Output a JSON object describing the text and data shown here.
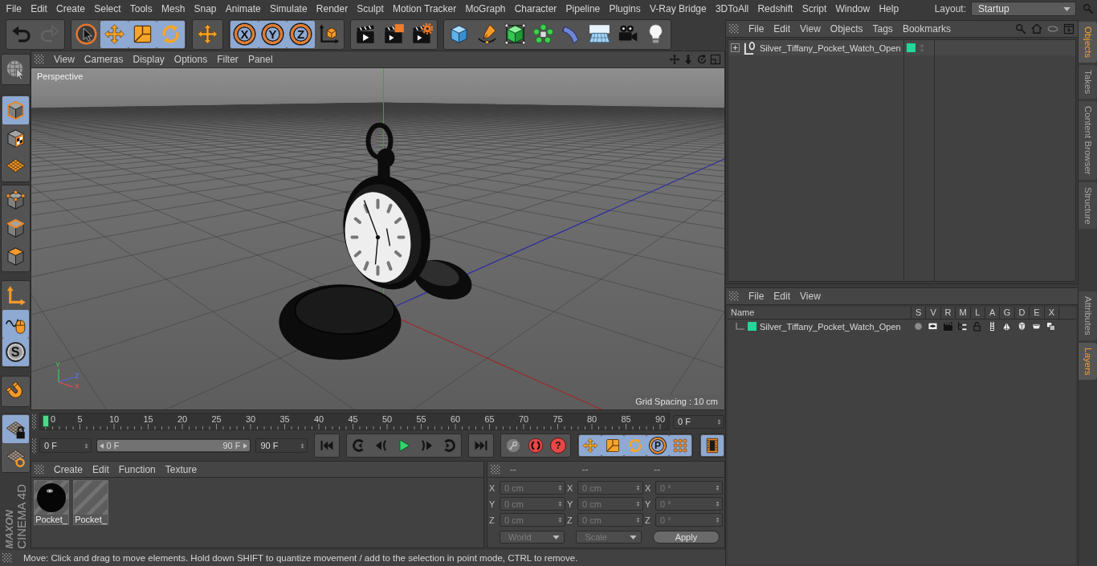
{
  "menu_bar": {
    "items": [
      "File",
      "Edit",
      "Create",
      "Select",
      "Tools",
      "Mesh",
      "Snap",
      "Animate",
      "Simulate",
      "Render",
      "Sculpt",
      "Motion Tracker",
      "MoGraph",
      "Character",
      "Pipeline",
      "Plugins",
      "V-Ray Bridge",
      "3DToAll",
      "Redshift",
      "Script",
      "Window",
      "Help"
    ],
    "layout_label": "Layout:",
    "layout_value": "Startup"
  },
  "toolbar": {
    "groups": [
      [
        {
          "kind": "undo",
          "active": false,
          "disabled": false
        },
        {
          "kind": "redo",
          "active": false,
          "disabled": true
        }
      ],
      [
        {
          "kind": "live-select",
          "active": false,
          "disabled": false
        },
        {
          "kind": "move",
          "active": true,
          "disabled": false
        },
        {
          "kind": "scale",
          "active": true,
          "disabled": false
        },
        {
          "kind": "rotate",
          "active": true,
          "disabled": false
        }
      ],
      [
        {
          "kind": "move",
          "active": false,
          "disabled": false
        }
      ],
      [
        {
          "kind": "axis-lock",
          "label": "X",
          "active": true,
          "disabled": false
        },
        {
          "kind": "axis-lock",
          "label": "Y",
          "active": true,
          "disabled": false
        },
        {
          "kind": "axis-lock",
          "label": "Z",
          "active": true,
          "disabled": false
        },
        {
          "kind": "coordinate-system",
          "active": false,
          "disabled": false
        }
      ],
      [
        {
          "kind": "render-view",
          "active": false,
          "disabled": false
        },
        {
          "kind": "render-picture-viewer",
          "active": false,
          "disabled": false
        },
        {
          "kind": "render-settings",
          "active": false,
          "disabled": false
        }
      ],
      [
        {
          "kind": "cube",
          "active": false,
          "disabled": false
        },
        {
          "kind": "pen",
          "active": false,
          "disabled": false
        },
        {
          "kind": "subdivision",
          "active": false,
          "disabled": false
        },
        {
          "kind": "cloner",
          "active": false,
          "disabled": false
        },
        {
          "kind": "deformer",
          "active": false,
          "disabled": false
        },
        {
          "kind": "floor",
          "active": false,
          "disabled": false
        },
        {
          "kind": "camera",
          "active": false,
          "disabled": false
        },
        {
          "kind": "light",
          "active": false,
          "disabled": false
        }
      ]
    ]
  },
  "left_toolbar": {
    "groups": [
      [
        {
          "kind": "make-editable",
          "active": false
        }
      ],
      [
        {
          "kind": "model",
          "active": true
        },
        {
          "kind": "texture",
          "active": false
        },
        {
          "kind": "workplane",
          "active": false
        }
      ],
      [
        {
          "kind": "points",
          "active": false
        },
        {
          "kind": "edges",
          "active": false
        },
        {
          "kind": "polygons",
          "active": false
        }
      ],
      [
        {
          "kind": "axis",
          "active": false
        },
        {
          "kind": "tweak",
          "active": true
        },
        {
          "kind": "solo",
          "label": "S",
          "active": true
        }
      ],
      [
        {
          "kind": "snap",
          "active": false
        }
      ],
      [
        {
          "kind": "workplane-lock",
          "active": true
        },
        {
          "kind": "workplane-rotate",
          "active": false
        }
      ]
    ]
  },
  "logo": {
    "brand": "MAXON",
    "product": "CINEMA 4D"
  },
  "viewport": {
    "menu": [
      "View",
      "Cameras",
      "Display",
      "Options",
      "Filter",
      "Panel"
    ],
    "camera": "Perspective",
    "grid_spacing": "Grid Spacing : 10 cm",
    "gizmo_labels": [
      "Y",
      "Z",
      "X"
    ]
  },
  "timeline": {
    "labels": [
      "0",
      "5",
      "10",
      "15",
      "20",
      "25",
      "30",
      "35",
      "40",
      "45",
      "50",
      "55",
      "60",
      "65",
      "70",
      "75",
      "80",
      "85",
      "90"
    ],
    "playhead": {
      "level": 0
    },
    "current_frame": "0 F"
  },
  "playback": {
    "start_frame": "0 F",
    "range": {
      "start": "0 F",
      "end": "90 F",
      "level": 1
    },
    "end_frame": "90 F",
    "groups": [
      [
        {
          "kind": "go-start",
          "active": false
        }
      ],
      [
        {
          "kind": "previous-key",
          "active": false
        },
        {
          "kind": "previous-frame",
          "active": false
        },
        {
          "kind": "play",
          "active": false
        },
        {
          "kind": "next-frame",
          "active": false
        },
        {
          "kind": "next-key",
          "active": false
        }
      ],
      [
        {
          "kind": "go-end",
          "active": false
        }
      ],
      [
        {
          "kind": "key-lock",
          "active": false
        },
        {
          "kind": "record",
          "active": false
        },
        {
          "kind": "autokey",
          "label": "?",
          "active": false
        }
      ],
      [
        {
          "kind": "move",
          "active": true
        },
        {
          "kind": "scale",
          "active": true
        },
        {
          "kind": "rotate",
          "active": true
        },
        {
          "kind": "parameter",
          "label": "P",
          "active": true
        },
        {
          "kind": "point-level",
          "active": true
        }
      ],
      [
        {
          "kind": "timeline",
          "active": true
        }
      ]
    ]
  },
  "materials": {
    "menu": [
      "Create",
      "Edit",
      "Function",
      "Texture"
    ],
    "items": [
      {
        "name": "Pocket_",
        "kind": "sphere"
      },
      {
        "name": "Pocket_",
        "kind": "blank"
      }
    ]
  },
  "coordinates": {
    "headers": [
      "--",
      "--",
      "--"
    ],
    "disabled": true,
    "rows": [
      [
        {
          "axis": "X",
          "value": "0 cm"
        },
        {
          "axis": "X",
          "value": "0 cm"
        },
        {
          "axis": "X",
          "value": "0 °"
        }
      ],
      [
        {
          "axis": "Y",
          "value": "0 cm"
        },
        {
          "axis": "Y",
          "value": "0 cm"
        },
        {
          "axis": "Y",
          "value": "0 °"
        }
      ],
      [
        {
          "axis": "Z",
          "value": "0 cm"
        },
        {
          "axis": "Z",
          "value": "0 cm"
        },
        {
          "axis": "Z",
          "value": "0 °"
        }
      ]
    ],
    "dropdowns": [
      "World",
      "Scale"
    ],
    "apply": "Apply"
  },
  "status_bar": {
    "text": "Move: Click and drag to move elements. Hold down SHIFT to quantize movement / add to the selection in point mode, CTRL to remove."
  },
  "object_manager": {
    "menu": [
      "File",
      "Edit",
      "View",
      "Objects",
      "Tags",
      "Bookmarks"
    ],
    "objects": [
      {
        "name": "Silver_Tiffany_Pocket_Watch_Open",
        "expanded": false,
        "color": "#21d79c"
      }
    ]
  },
  "side_tabs_top": [
    {
      "label": "Objects",
      "selected": true
    },
    {
      "label": "Takes",
      "selected": false
    },
    {
      "label": "Content Browser",
      "selected": false
    },
    {
      "label": "Structure",
      "selected": false
    }
  ],
  "layer_manager": {
    "menu": [
      "File",
      "Edit",
      "View"
    ],
    "columns": [
      "Name",
      "S",
      "V",
      "R",
      "M",
      "L",
      "A",
      "G",
      "D",
      "E",
      "X"
    ],
    "layers": [
      {
        "name": "Silver_Tiffany_Pocket_Watch_Open",
        "color": "#21d79c"
      }
    ]
  },
  "side_tabs_bottom": [
    {
      "label": "Attributes",
      "selected": false
    },
    {
      "label": "Layers",
      "selected": true
    }
  ]
}
